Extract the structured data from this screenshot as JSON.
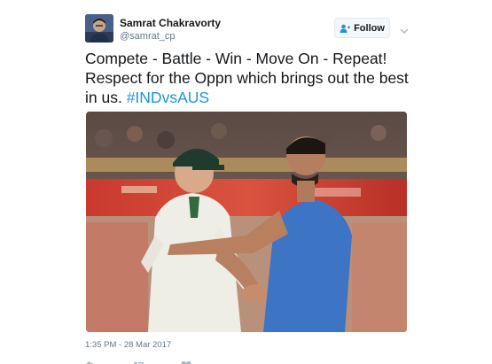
{
  "author": {
    "display_name": "Samrat Chakravorty",
    "handle": "@samrat_cp"
  },
  "follow_button": {
    "label": "Follow"
  },
  "tweet": {
    "line1": "Compete - Battle - Win - Move On - Repeat!",
    "line2": "Respect for the Oppn which brings out the best",
    "line3_prefix": "in us. ",
    "hashtag": "#INDvsAUS"
  },
  "timestamp": "1:35 PM - 28 Mar 2017",
  "colors": {
    "link": "#1b95e0",
    "secondary_text": "#657786",
    "primary_text": "#14171a"
  },
  "icons": {
    "follow": "add-user-icon",
    "more": "chevron-down-icon",
    "reply": "reply-icon",
    "retweet": "retweet-icon",
    "like": "heart-icon"
  }
}
